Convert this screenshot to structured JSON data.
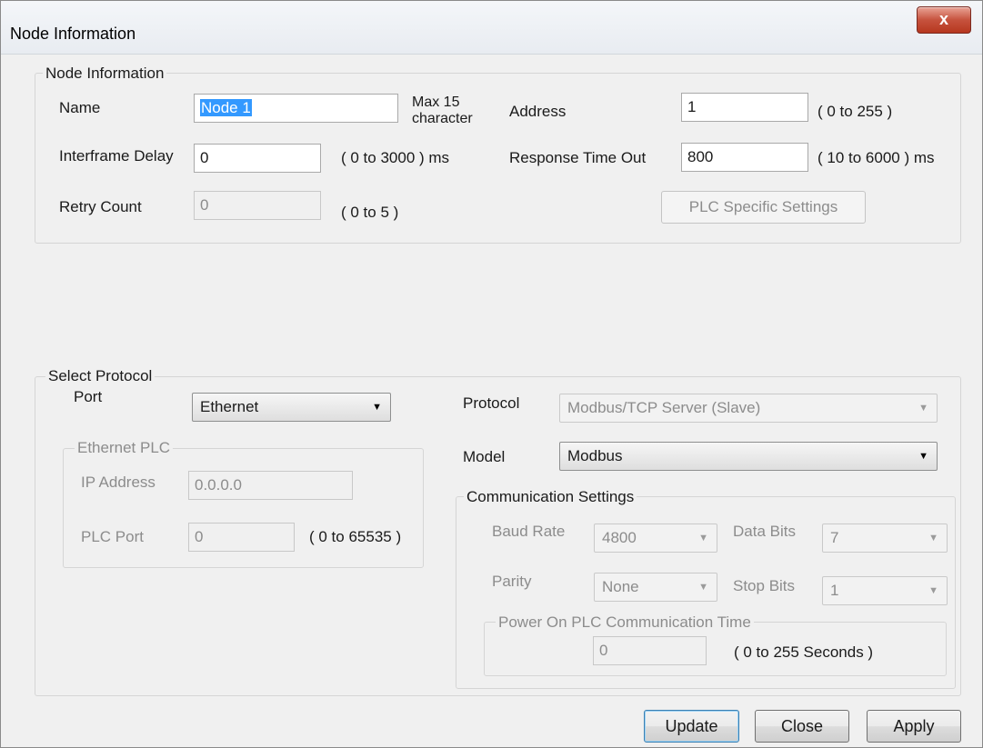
{
  "window": {
    "title": "Node Information",
    "close": "x"
  },
  "node": {
    "legend": "Node Information",
    "name_label": "Name",
    "name_value": "Node 1",
    "max_note": "Max 15\ncharacter",
    "address_label": "Address",
    "address_value": "1",
    "address_range": "( 0 to 255 )",
    "interframe_label": "Interframe Delay",
    "interframe_value": "0",
    "interframe_range": "( 0 to 3000 ) ms",
    "timeout_label": "Response Time Out",
    "timeout_value": "800",
    "timeout_range": "( 10 to 6000 ) ms",
    "retry_label": "Retry Count",
    "retry_value": "0",
    "retry_range": "( 0 to 5 )",
    "plc_settings_button": "PLC Specific Settings"
  },
  "protocol": {
    "legend": "Select Protocol",
    "port_label": "Port",
    "port_value": "Ethernet",
    "protocol_label": "Protocol",
    "protocol_value": "Modbus/TCP Server (Slave)",
    "model_label": "Model",
    "model_value": "Modbus",
    "ethernet": {
      "legend": "Ethernet PLC",
      "ip_label": "IP Address",
      "ip_value": "0.0.0.0",
      "port_label": "PLC Port",
      "port_value": "0",
      "port_range": "( 0 to 65535 )"
    },
    "comm": {
      "legend": "Communication Settings",
      "baud_label": "Baud Rate",
      "baud_value": "4800",
      "databits_label": "Data Bits",
      "databits_value": "7",
      "parity_label": "Parity",
      "parity_value": "None",
      "stopbits_label": "Stop Bits",
      "stopbits_value": "1",
      "power_legend": "Power On PLC Communication Time",
      "power_value": "0",
      "power_range": "( 0 to 255 Seconds )"
    }
  },
  "buttons": {
    "update": "Update",
    "close": "Close",
    "apply": "Apply"
  },
  "icons": {
    "dropdown": "chevron-down-icon",
    "close": "close-icon"
  }
}
